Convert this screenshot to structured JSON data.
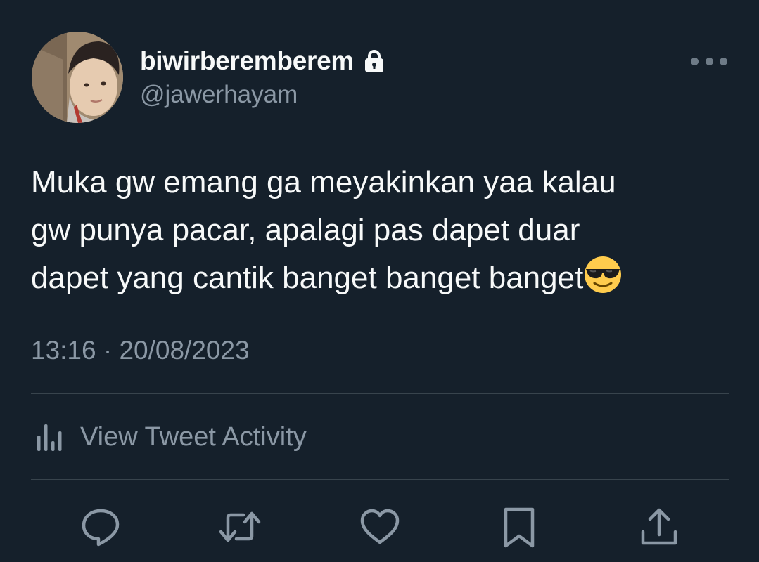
{
  "author": {
    "display_name": "biwirberemberem",
    "handle": "@jawerhayam",
    "protected_icon": "lock-icon",
    "avatar": "profile-photo"
  },
  "more_icon": "more-horizontal-icon",
  "tweet": {
    "lines": [
      "Muka gw emang ga meyakinkan yaa kalau",
      "gw punya pacar, apalagi pas dapet duar",
      "dapet yang cantik banget banget banget"
    ],
    "trailing_emoji": "smiling-face-with-sunglasses-emoji",
    "timestamp": "13:16 · 20/08/2023"
  },
  "activity": {
    "label": "View Tweet Activity",
    "icon": "bar-chart-icon"
  },
  "actions": [
    {
      "name": "reply",
      "icon": "reply-icon"
    },
    {
      "name": "retweet",
      "icon": "retweet-icon"
    },
    {
      "name": "like",
      "icon": "heart-icon"
    },
    {
      "name": "bookmark",
      "icon": "bookmark-icon"
    },
    {
      "name": "share",
      "icon": "share-icon"
    }
  ],
  "colors": {
    "background": "#15202b",
    "primary_text": "#f7f9f9",
    "secondary_text": "#8b98a5",
    "divider": "#38444d",
    "icon": "#8b98a5"
  }
}
